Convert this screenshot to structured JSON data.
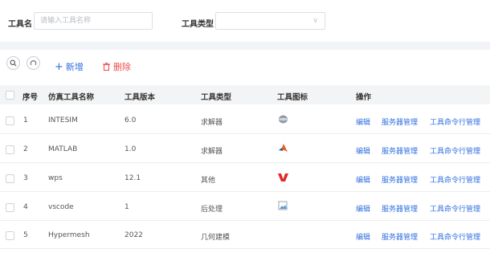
{
  "filters": {
    "name_label": "工具名",
    "name_placeholder": "请输入工具名称",
    "type_label": "工具类型",
    "type_value": ""
  },
  "toolbar": {
    "add_label": "新增",
    "delete_label": "删除"
  },
  "table": {
    "headers": {
      "index": "序号",
      "name": "仿真工具名称",
      "version": "工具版本",
      "type": "工具类型",
      "icon": "工具图标",
      "ops": "操作"
    },
    "rows": [
      {
        "index": "1",
        "name": "INTESIM",
        "version": "6.0",
        "type": "求解器",
        "icon": "sphere-app-icon"
      },
      {
        "index": "2",
        "name": "MATLAB",
        "version": "1.0",
        "type": "求解器",
        "icon": "matlab-icon"
      },
      {
        "index": "3",
        "name": "wps",
        "version": "12.1",
        "type": "其他",
        "icon": "wps-icon"
      },
      {
        "index": "4",
        "name": "vscode",
        "version": "1",
        "type": "后处理",
        "icon": "broken-image-icon"
      },
      {
        "index": "5",
        "name": "Hypermesh",
        "version": "2022",
        "type": "几何建模",
        "icon": ""
      }
    ],
    "ops": {
      "edit": "编辑",
      "server": "服务器管理",
      "cmd": "工具命令行管理"
    }
  },
  "colors": {
    "link": "#2f6fe0",
    "danger": "#f04d4d",
    "header_bg": "#f3f4f6"
  }
}
